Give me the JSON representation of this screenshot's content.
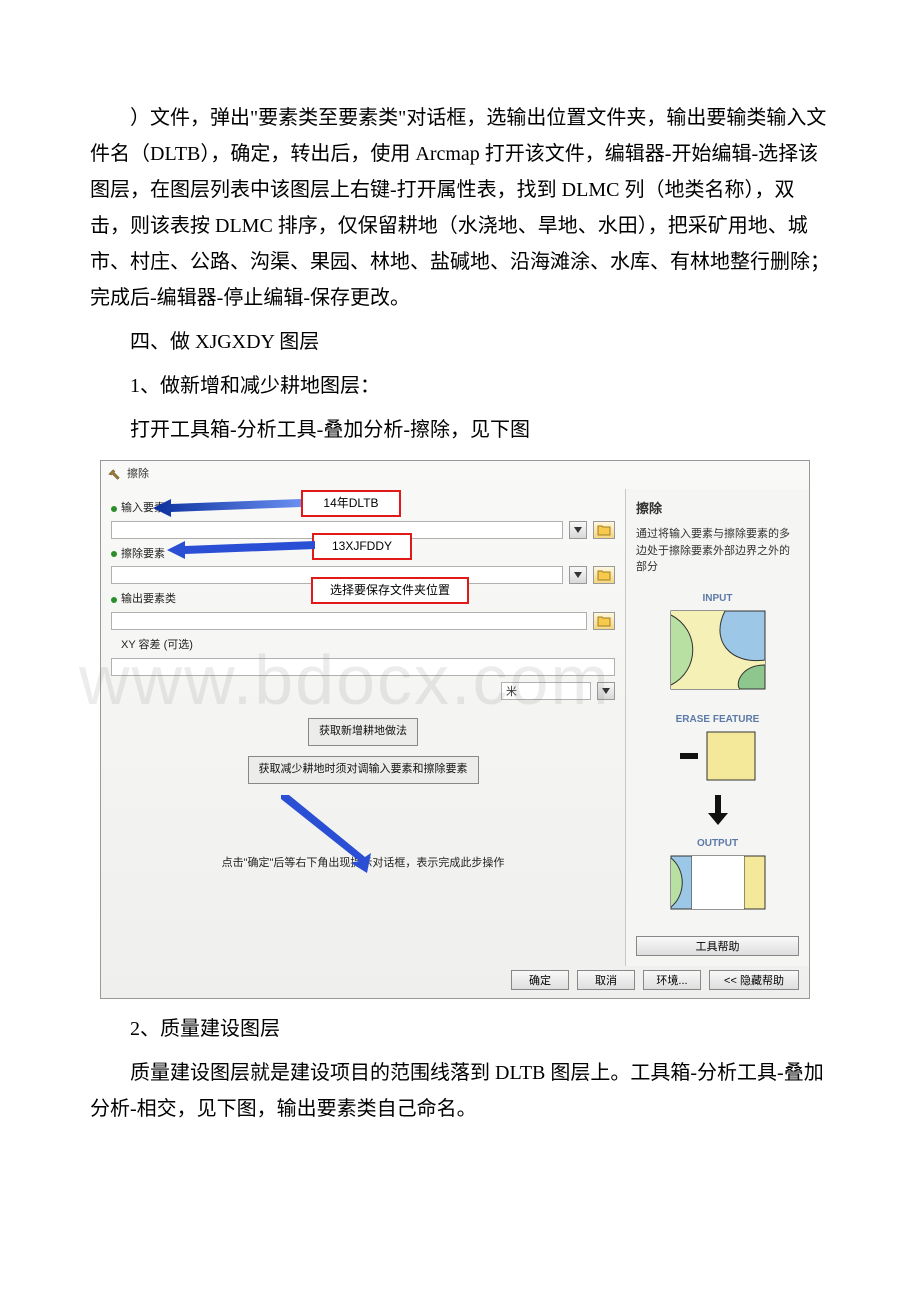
{
  "doc": {
    "para1": "）文件，弹出\"要素类至要素类\"对话框，选输出位置文件夹，输出要输类输入文件名（DLTB），确定，转出后，使用 Arcmap 打开该文件，编辑器-开始编辑-选择该图层，在图层列表中该图层上右键-打开属性表，找到 DLMC 列（地类名称），双击，则该表按 DLMC 排序，仅保留耕地（水浇地、旱地、水田），把采矿用地、城市、村庄、公路、沟渠、果园、林地、盐碱地、沿海滩涂、水库、有林地整行删除；完成后-编辑器-停止编辑-保存更改。",
    "h1": "四、做 XJGXDY 图层",
    "p2": "1、做新增和减少耕地图层：",
    "p3": "打开工具箱-分析工具-叠加分析-擦除，见下图",
    "p4": "2、质量建设图层",
    "p5": "质量建设图层就是建设项目的范围线落到 DLTB 图层上。工具箱-分析工具-叠加分析-相交，见下图，输出要素类自己命名。"
  },
  "dialog": {
    "title": "擦除",
    "labels": {
      "input": "输入要素",
      "erase": "擦除要素",
      "output": "输出要素类",
      "xy": "XY 容差 (可选)",
      "unit": "米"
    },
    "redboxes": {
      "r1": "14年DLTB",
      "r2": "13XJFDDY",
      "r3": "选择要保存文件夹位置"
    },
    "annot": {
      "a1": "获取新增耕地做法",
      "a2": "获取减少耕地时须对调输入要素和擦除要素",
      "hint": "点击\"确定\"后等右下角出现提示对话框，表示完成此步操作"
    },
    "buttons": {
      "ok": "确定",
      "cancel": "取消",
      "env": "环境...",
      "hidehelp": "<<  隐藏帮助",
      "toolhelp": "工具帮助"
    },
    "help": {
      "title": "擦除",
      "body": "通过将输入要素与擦除要素的多边处于擦除要素外部边界之外的部分",
      "labels": {
        "input": "INPUT",
        "erase": "ERASE FEATURE",
        "output": "OUTPUT"
      }
    }
  },
  "watermark": "www.bdocx.com"
}
